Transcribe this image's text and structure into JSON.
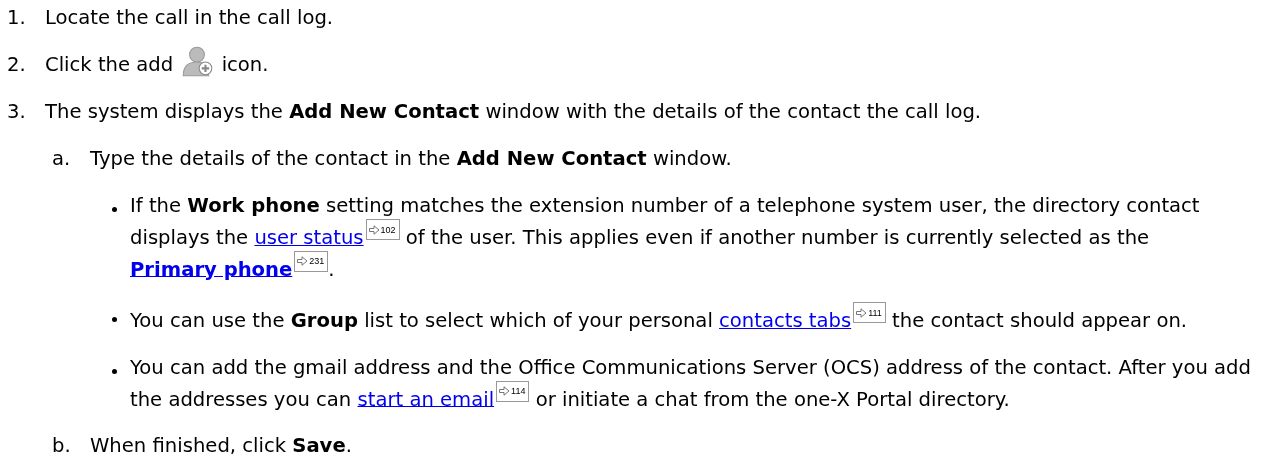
{
  "steps": [
    {
      "number": "1.",
      "content": [
        {
          "kind": "text",
          "text": "Locate the call in the call log."
        }
      ]
    },
    {
      "number": "2.",
      "content": [
        {
          "kind": "text",
          "text": "Click the add "
        },
        {
          "kind": "icon"
        },
        {
          "kind": "text",
          "text": " icon."
        }
      ]
    },
    {
      "number": "3.",
      "content": [
        {
          "kind": "text",
          "text": "The system displays the **Add New Contact** window with the details of the contact the call log."
        }
      ],
      "substeps": [
        {
          "letter": "a.",
          "content": [
            {
              "kind": "text",
              "text": "Type the details of the contact in the **Add New Contact** window."
            }
          ],
          "bullets": [
            {
              "content": [
                {
                  "kind": "text",
                  "text": "If the **Work phone** setting matches the extension number of a telephone system user, the directory contact displays the "
                },
                {
                  "kind": "link",
                  "text": "user status",
                  "bold": false
                },
                {
                  "kind": "ref",
                  "text": "102"
                },
                {
                  "kind": "text",
                  "text": " of the user. This applies even if another number is currently selected as the "
                },
                {
                  "kind": "link",
                  "text": "Primary phone",
                  "bold": true
                },
                {
                  "kind": "ref",
                  "text": "231"
                },
                {
                  "kind": "text",
                  "text": "."
                }
              ]
            },
            {
              "content": [
                {
                  "kind": "text",
                  "text": "You can use the **Group** list to select which of your personal "
                },
                {
                  "kind": "link",
                  "text": "contacts tabs",
                  "bold": false
                },
                {
                  "kind": "ref",
                  "text": "111"
                },
                {
                  "kind": "text",
                  "text": " the contact should appear on."
                }
              ]
            },
            {
              "content": [
                {
                  "kind": "text",
                  "text": "You can add the gmail address and the Office Communications Server (OCS) address of the contact. After you add the addresses you can "
                },
                {
                  "kind": "link",
                  "text": "start an email",
                  "bold": false
                },
                {
                  "kind": "ref",
                  "text": "114"
                },
                {
                  "kind": "text",
                  "text": " or initiate a chat from the one-X Portal directory."
                }
              ]
            }
          ]
        },
        {
          "letter": "b.",
          "content": [
            {
              "kind": "text",
              "text": "When finished, click **Save**."
            }
          ]
        }
      ]
    }
  ]
}
